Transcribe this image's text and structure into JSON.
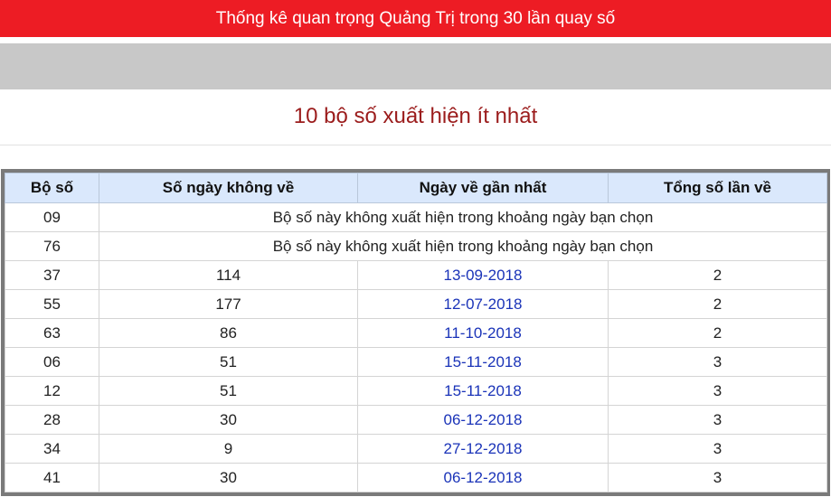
{
  "header": {
    "title": "Thống kê quan trọng Quảng Trị trong 30 lần quay số"
  },
  "subtitle": "10 bộ số xuất hiện ít nhất",
  "table": {
    "columns": [
      "Bộ số",
      "Số ngày không về",
      "Ngày về gần nhất",
      "Tổng số lần về"
    ],
    "missing_rows": [
      {
        "number": "09",
        "message": "Bộ số này không xuất hiện trong khoảng ngày bạn chọn"
      },
      {
        "number": "76",
        "message": "Bộ số này không xuất hiện trong khoảng ngày bạn chọn"
      }
    ],
    "rows": [
      {
        "number": "37",
        "days_missing": "114",
        "last_date": "13-09-2018",
        "total": "2"
      },
      {
        "number": "55",
        "days_missing": "177",
        "last_date": "12-07-2018",
        "total": "2"
      },
      {
        "number": "63",
        "days_missing": "86",
        "last_date": "11-10-2018",
        "total": "2"
      },
      {
        "number": "06",
        "days_missing": "51",
        "last_date": "15-11-2018",
        "total": "3"
      },
      {
        "number": "12",
        "days_missing": "51",
        "last_date": "15-11-2018",
        "total": "3"
      },
      {
        "number": "28",
        "days_missing": "30",
        "last_date": "06-12-2018",
        "total": "3"
      },
      {
        "number": "34",
        "days_missing": "9",
        "last_date": "27-12-2018",
        "total": "3"
      },
      {
        "number": "41",
        "days_missing": "30",
        "last_date": "06-12-2018",
        "total": "3"
      }
    ]
  },
  "colors": {
    "banner": "#ed1c24",
    "subtitle": "#9b1c1c",
    "header_bg": "#dae8fc",
    "date_link": "#1a33b8"
  }
}
